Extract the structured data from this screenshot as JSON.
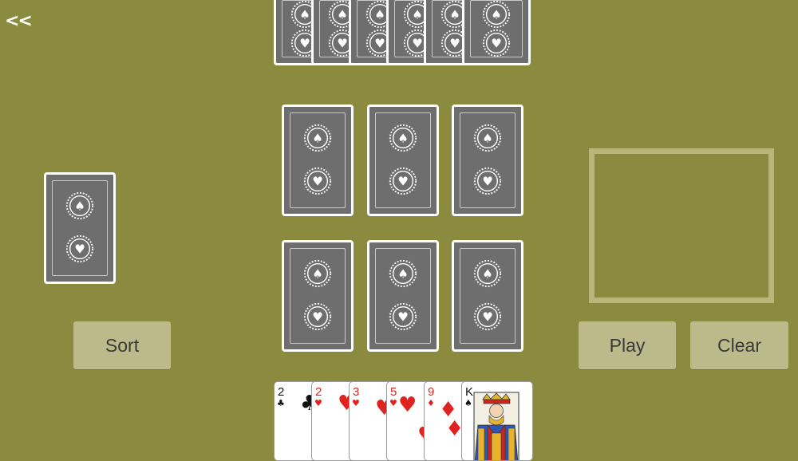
{
  "nav": {
    "back_label": "<<"
  },
  "buttons": {
    "sort": "Sort",
    "play": "Play",
    "clear": "Clear"
  },
  "player_hand": [
    {
      "rank": "2",
      "suit": "clubs",
      "suit_symbol": "♣",
      "color": "black"
    },
    {
      "rank": "2",
      "suit": "hearts",
      "suit_symbol": "♥",
      "color": "red"
    },
    {
      "rank": "3",
      "suit": "hearts",
      "suit_symbol": "♥",
      "color": "red"
    },
    {
      "rank": "5",
      "suit": "hearts",
      "suit_symbol": "♥",
      "color": "red"
    },
    {
      "rank": "9",
      "suit": "diamonds",
      "suit_symbol": "♦",
      "color": "red"
    },
    {
      "rank": "K",
      "suit": "spades",
      "suit_symbol": "♠",
      "color": "black"
    }
  ],
  "colors": {
    "table": "#8b8b3f",
    "card_back": "#6e6e6e",
    "button": "#bcb98a",
    "drop_zone_border": "#b9b67a"
  },
  "icons": {
    "card_emblem": "spade-heart-rosette-icon"
  }
}
